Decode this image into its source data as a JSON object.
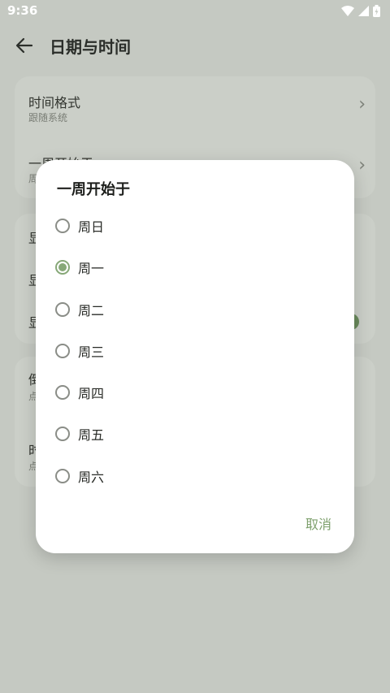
{
  "status": {
    "time": "9:36"
  },
  "appbar": {
    "title": "日期与时间"
  },
  "settings": {
    "time_format": {
      "title": "时间格式",
      "subtitle": "跟随系统"
    },
    "week_start": {
      "title": "一周开始于",
      "subtitle": "周一"
    },
    "section2_rows": [
      "显",
      "显",
      "显"
    ],
    "section3_rows": [
      {
        "title": "倒",
        "subtitle": "点"
      },
      {
        "title": "时",
        "subtitle": "点"
      }
    ]
  },
  "dialog": {
    "title": "一周开始于",
    "options": [
      "周日",
      "周一",
      "周二",
      "周三",
      "周四",
      "周五",
      "周六"
    ],
    "selected_index": 1,
    "cancel_label": "取消",
    "accent_color": "#87a878"
  }
}
